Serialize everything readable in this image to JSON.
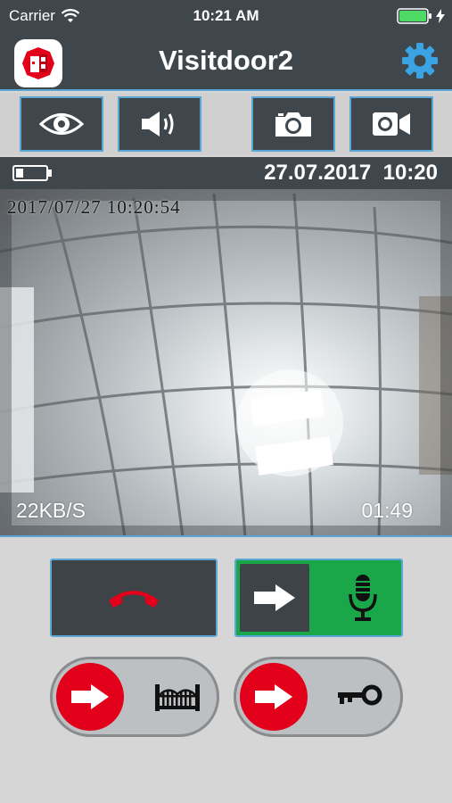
{
  "status_bar": {
    "carrier": "Carrier",
    "time": "10:21 AM",
    "battery_color": "#4cd964"
  },
  "header": {
    "title": "Visitdoor2",
    "logo_icon": "visitdoor-logo-icon",
    "settings_icon": "gear-icon",
    "accent_color": "#5aa7d6"
  },
  "toolbar": {
    "buttons": [
      {
        "icon": "eye-icon"
      },
      {
        "icon": "speaker-icon"
      },
      {
        "icon": "camera-icon"
      },
      {
        "icon": "video-camera-icon"
      }
    ]
  },
  "info_bar": {
    "battery_icon": "battery-low-icon",
    "date_time": "27.07.2017  10:20"
  },
  "video": {
    "timestamp_overlay": "2017/07/27 10:20:54",
    "data_rate": "22KB/S",
    "duration": "01:49"
  },
  "controls": {
    "hangup_icon": "phone-hangup-icon",
    "hangup_color": "#e3001b",
    "talk_arrow_icon": "arrow-right-icon",
    "talk_mic_icon": "microphone-icon",
    "talk_color": "#1aa74a",
    "gate_arrow_icon": "arrow-right-icon",
    "gate_icon": "gate-icon",
    "door_arrow_icon": "arrow-right-icon",
    "door_icon": "key-icon"
  }
}
